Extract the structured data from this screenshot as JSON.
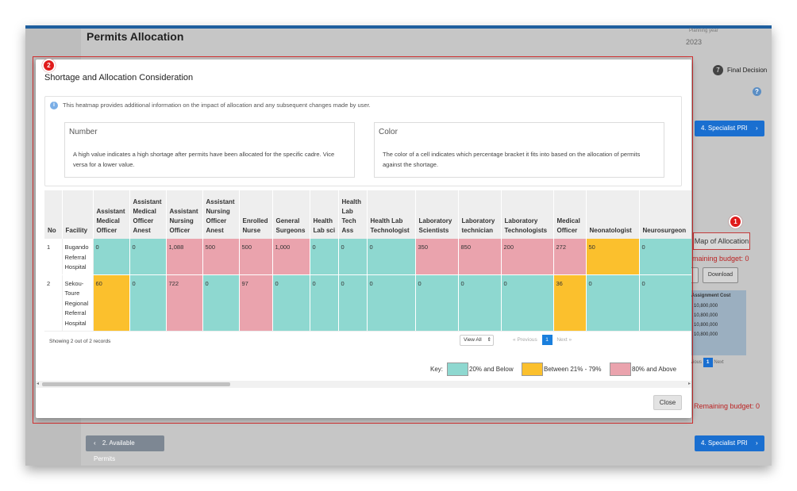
{
  "background": {
    "page_title": "Permits Allocation",
    "planning_year_label": "Planning year",
    "planning_year_value": "2023",
    "step_number": "7",
    "step_label": "Final Decision",
    "specialist_button_label": "4. Specialist PRI",
    "map_button_label": "Map of Allocation",
    "remaining_budget_text": "maining budget: 0",
    "remaining_budget_text_bottom": "Remaining budget: 0",
    "download_label": "Download",
    "assignment_cost_header": "Assignment Cost",
    "assignment_costs": [
      "10,800,000",
      "10,800,000",
      "10,800,000",
      "10,800,000"
    ],
    "pager_prev": "vious",
    "pager_page": "1",
    "pager_next": "Next",
    "back_button_label": "2. Available Permits"
  },
  "callouts": {
    "map_badge": "1",
    "modal_badge": "2"
  },
  "modal": {
    "title": "Shortage and Allocation Consideration",
    "info_text": "This heatmap provides additional information on the impact of allocation and any subsequent changes made by user.",
    "number_card": {
      "heading": "Number",
      "text": "A high value indicates a high shortage after permits have been allocated for the specific cadre. Vice versa for a lower value."
    },
    "color_card": {
      "heading": "Color",
      "text": "The color of a cell indicates which percentage bracket it fits into based on the allocation of permits against the shortage."
    },
    "table": {
      "columns": [
        "No",
        "Facility",
        "Assistant Medical Officer",
        "Assistant Medical Officer Anest",
        "Assistant Nursing Officer",
        "Assistant Nursing Officer Anest",
        "Enrolled Nurse",
        "General Surgeons",
        "Health Lab sci",
        "Health Lab Tech Ass",
        "Health Lab Technologist",
        "Laboratory Scientists",
        "Laboratory technician",
        "Laboratory Technologists",
        "Medical Officer",
        "Neonatologist",
        "Neurosurgeon"
      ],
      "rows": [
        {
          "no": "1",
          "facility": "Bugando Referral Hospital",
          "values": [
            "0",
            "0",
            "1,088",
            "500",
            "500",
            "1,000",
            "0",
            "0",
            "0",
            "350",
            "850",
            "200",
            "272",
            "50",
            "0"
          ],
          "colors": [
            "low",
            "low",
            "high",
            "high",
            "high",
            "high",
            "low",
            "low",
            "low",
            "high",
            "high",
            "high",
            "high",
            "mid",
            "low"
          ]
        },
        {
          "no": "2",
          "facility": "Sekou-Toure Regional Referral Hospital",
          "values": [
            "60",
            "0",
            "722",
            "0",
            "97",
            "0",
            "0",
            "0",
            "0",
            "0",
            "0",
            "0",
            "36",
            "0",
            "0"
          ],
          "colors": [
            "mid",
            "low",
            "high",
            "low",
            "high",
            "low",
            "low",
            "low",
            "low",
            "low",
            "low",
            "low",
            "mid",
            "low",
            "low"
          ]
        }
      ]
    },
    "records_text": "Showing 2 out of 2 records",
    "view_all_label": "View All",
    "pager": {
      "previous": "Previous",
      "page": "1",
      "next": "Next"
    },
    "key": {
      "label": "Key:",
      "items": [
        {
          "label": "20% and Below",
          "color": "#8ed8d0"
        },
        {
          "label": "Between 21% - 79%",
          "color": "#fbc02d"
        },
        {
          "label": "80% and Above",
          "color": "#eaa3ad"
        }
      ]
    },
    "close_label": "Close"
  }
}
